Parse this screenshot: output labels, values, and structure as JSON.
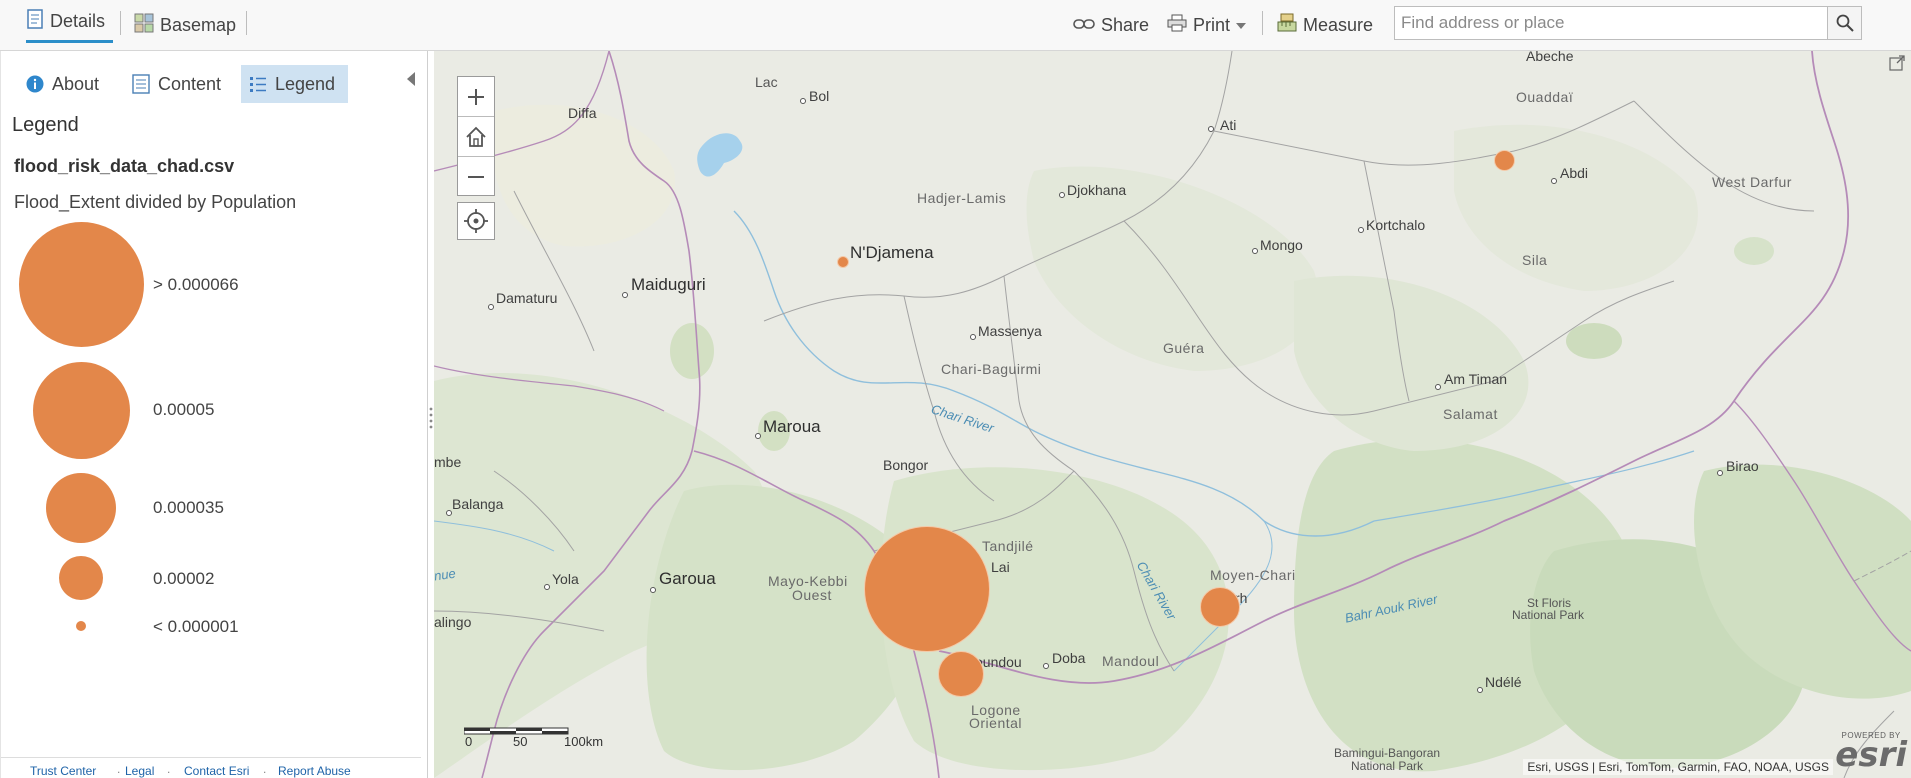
{
  "toolbar": {
    "details_label": "Details",
    "basemap_label": "Basemap",
    "share_label": "Share",
    "print_label": "Print",
    "measure_label": "Measure",
    "search_placeholder": "Find address or place"
  },
  "panel": {
    "tabs": [
      {
        "label": "About",
        "icon": "info-icon"
      },
      {
        "label": "Content",
        "icon": "content-list-icon"
      },
      {
        "label": "Legend",
        "icon": "legend-list-icon",
        "active": true
      }
    ],
    "legend_heading": "Legend",
    "layer_name": "flood_risk_data_chad.csv",
    "field_description": "Flood_Extent divided by Population",
    "legend_items": [
      {
        "label": "> 0.000066"
      },
      {
        "label": "0.00005"
      },
      {
        "label": "0.000035"
      },
      {
        "label": "0.00002"
      },
      {
        "label": "< 0.000001"
      }
    ],
    "footer_links": [
      "Trust Center",
      "Legal",
      "Contact Esri",
      "Report Abuse"
    ]
  },
  "map": {
    "places": [
      {
        "name": "Abeche"
      },
      {
        "name": "Ouaddaï"
      },
      {
        "name": "Lac"
      },
      {
        "name": "Bol"
      },
      {
        "name": "Diffa"
      },
      {
        "name": "Ati"
      },
      {
        "name": "Abdi"
      },
      {
        "name": "West Darfur"
      },
      {
        "name": "Hadjer-Lamis"
      },
      {
        "name": "Djokhana"
      },
      {
        "name": "N'Djamena"
      },
      {
        "name": "Kortchalo"
      },
      {
        "name": "Mongo"
      },
      {
        "name": "Sila"
      },
      {
        "name": "Damaturu"
      },
      {
        "name": "Maiduguri"
      },
      {
        "name": "Massenya"
      },
      {
        "name": "Guéra"
      },
      {
        "name": "Chari-Baguirmi"
      },
      {
        "name": "Am Timan"
      },
      {
        "name": "Salamat"
      },
      {
        "name": "Chari River"
      },
      {
        "name": "Maroua"
      },
      {
        "name": "Bongor"
      },
      {
        "name": "mbe"
      },
      {
        "name": "Birao"
      },
      {
        "name": "Balanga"
      },
      {
        "name": "Tandjilé"
      },
      {
        "name": "Lai"
      },
      {
        "name": "Chari River"
      },
      {
        "name": "nue"
      },
      {
        "name": "Mayo-Kebbi"
      },
      {
        "name": "Ouest"
      },
      {
        "name": "Garoua"
      },
      {
        "name": "Yola"
      },
      {
        "name": "Moyen-Chari"
      },
      {
        "name": "rh"
      },
      {
        "name": "Bahr Aouk River"
      },
      {
        "name": "St Floris"
      },
      {
        "name": "National Park"
      },
      {
        "name": "alingo"
      },
      {
        "name": "oundou"
      },
      {
        "name": "Doba"
      },
      {
        "name": "Mandoul"
      },
      {
        "name": "Ndélé"
      },
      {
        "name": "Logone"
      },
      {
        "name": "Oriental"
      },
      {
        "name": "Bamingui-Bangoran"
      },
      {
        "name": "National Park"
      }
    ],
    "scale_labels": [
      "0",
      "50",
      "100km"
    ],
    "attribution": "Esri, USGS | Esri, TomTom, Garmin, FAO, NOAA, USGS",
    "logo_powered": "POWERED BY",
    "logo_name": "esri",
    "flood_color": "#e3874a"
  }
}
